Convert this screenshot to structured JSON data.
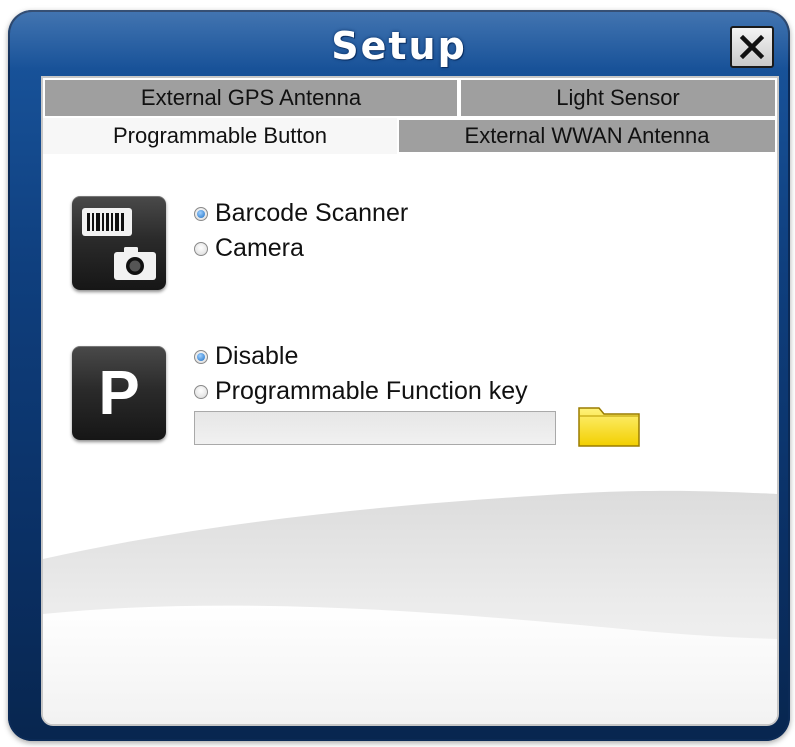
{
  "window": {
    "title": "Setup",
    "close_label": "✕",
    "accent": "#0f3f7e"
  },
  "tabs": {
    "row1": [
      {
        "label": "External GPS Antenna",
        "active": false
      },
      {
        "label": "Light Sensor",
        "active": false
      }
    ],
    "row2": [
      {
        "label": "Programmable Button",
        "active": true
      },
      {
        "label": "External WWAN Antenna",
        "active": false
      }
    ]
  },
  "scanner_group": {
    "icon": "barcode-camera-icon",
    "options": [
      {
        "label": "Barcode Scanner",
        "checked": true
      },
      {
        "label": "Camera",
        "checked": false
      }
    ]
  },
  "button_group": {
    "icon": "p-key-icon",
    "icon_letter": "P",
    "options": [
      {
        "label": "Disable",
        "checked": true
      },
      {
        "label": "Programmable Function key",
        "checked": false
      }
    ],
    "function_key_value": "",
    "browse_icon": "folder-icon"
  }
}
